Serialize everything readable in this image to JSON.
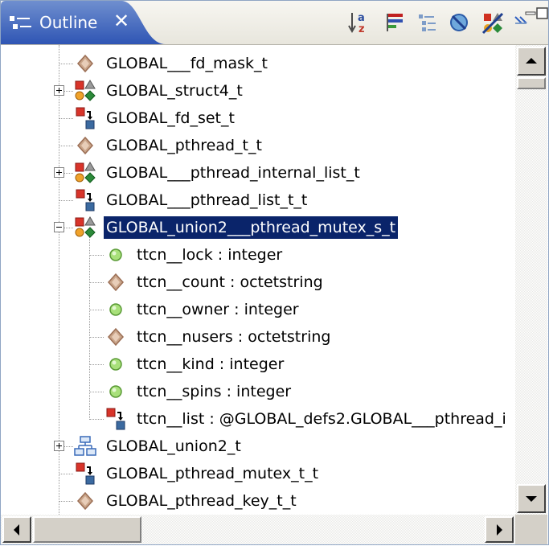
{
  "tab": {
    "title": "Outline",
    "close_glyph": "✕"
  },
  "toolbar": [
    {
      "name": "sort-alphabetically-icon"
    },
    {
      "name": "hide-fields-icon"
    },
    {
      "name": "hide-static-icon"
    },
    {
      "name": "hide-nonpublic-icon"
    },
    {
      "name": "hide-local-types-icon"
    },
    {
      "name": "link-with-editor-icon"
    }
  ],
  "window_controls": {
    "minimize": "minimize-icon",
    "maximize": "maximize-icon"
  },
  "tree": {
    "rows": [
      {
        "label": "GLOBAL___fd_mask_t",
        "icon": "diamond-icon",
        "expander": "",
        "level": 0
      },
      {
        "label": "GLOBAL_struct4_t",
        "icon": "struct-icon",
        "expander": "plus",
        "level": 0
      },
      {
        "label": "GLOBAL_fd_set_t",
        "icon": "reference-icon",
        "expander": "",
        "level": 0
      },
      {
        "label": "GLOBAL_pthread_t_t",
        "icon": "diamond-icon",
        "expander": "",
        "level": 0
      },
      {
        "label": "GLOBAL___pthread_internal_list_t",
        "icon": "struct-icon",
        "expander": "plus",
        "level": 0
      },
      {
        "label": "GLOBAL___pthread_list_t_t",
        "icon": "reference-icon",
        "expander": "",
        "level": 0
      },
      {
        "label": "GLOBAL_union2___pthread_mutex_s_t",
        "icon": "struct-icon",
        "expander": "minus",
        "level": 0,
        "selected": true
      },
      {
        "label": "ttcn__lock : integer",
        "icon": "circle-icon",
        "expander": "",
        "level": 1
      },
      {
        "label": "ttcn__count : octetstring",
        "icon": "diamond-icon",
        "expander": "",
        "level": 1
      },
      {
        "label": "ttcn__owner : integer",
        "icon": "circle-icon",
        "expander": "",
        "level": 1
      },
      {
        "label": "ttcn__nusers : octetstring",
        "icon": "diamond-icon",
        "expander": "",
        "level": 1
      },
      {
        "label": "ttcn__kind : integer",
        "icon": "circle-icon",
        "expander": "",
        "level": 1
      },
      {
        "label": "ttcn__spins : integer",
        "icon": "circle-icon",
        "expander": "",
        "level": 1
      },
      {
        "label": "ttcn__list : @GLOBAL_defs2.GLOBAL___pthread_i",
        "icon": "reference-icon",
        "expander": "",
        "level": 1
      },
      {
        "label": "GLOBAL_union2_t",
        "icon": "union-icon",
        "expander": "plus",
        "level": 0
      },
      {
        "label": "GLOBAL_pthread_mutex_t_t",
        "icon": "reference-icon",
        "expander": "",
        "level": 0
      },
      {
        "label": "GLOBAL_pthread_key_t_t",
        "icon": "diamond-icon",
        "expander": "",
        "level": 0
      },
      {
        "label": "",
        "icon": "reference-icon",
        "expander": "",
        "level": 0
      }
    ]
  }
}
